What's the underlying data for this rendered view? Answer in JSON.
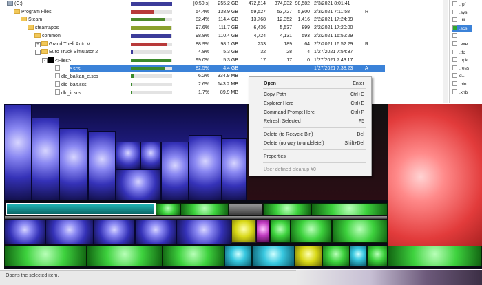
{
  "tree": {
    "rows": [
      {
        "indent": 0,
        "icon": "drive",
        "expander": "",
        "name": "(C:)",
        "fill": 1.0,
        "fill_color": "#3c3c9a",
        "percent": "[0:50 s]",
        "size": "255.2 GB",
        "items": "472,614",
        "files": "374,032",
        "subdirs": "98,582",
        "modified": "2/3/2021 8:01:41",
        "attr": ""
      },
      {
        "indent": 1,
        "icon": "folder",
        "expander": "",
        "name": "Program Files",
        "fill": 0.544,
        "fill_color": "#b83a3a",
        "percent": "54.4%",
        "size": "138.9 GB",
        "items": "59,527",
        "files": "53,727",
        "subdirs": "5,800",
        "modified": "2/3/2021 7:11:58",
        "attr": "R"
      },
      {
        "indent": 2,
        "icon": "folder",
        "expander": "",
        "name": "Steam",
        "fill": 0.824,
        "fill_color": "#4d8a2c",
        "percent": "82.4%",
        "size": "114.4 GB",
        "items": "13,768",
        "files": "12,352",
        "subdirs": "1,416",
        "modified": "2/2/2021 17:24:09",
        "attr": ""
      },
      {
        "indent": 3,
        "icon": "folder",
        "expander": "",
        "name": "steamapps",
        "fill": 0.976,
        "fill_color": "#8ba12e",
        "percent": "97.6%",
        "size": "111.7 GB",
        "items": "6,436",
        "files": "5,537",
        "subdirs": "899",
        "modified": "2/2/2021 17:20:00",
        "attr": ""
      },
      {
        "indent": 4,
        "icon": "folder",
        "expander": "",
        "name": "common",
        "fill": 0.988,
        "fill_color": "#3c3c9a",
        "percent": "98.8%",
        "size": "110.4 GB",
        "items": "4,724",
        "files": "4,131",
        "subdirs": "593",
        "modified": "2/2/2021 16:52:29",
        "attr": ""
      },
      {
        "indent": 5,
        "icon": "folder",
        "expander": "+",
        "name": "Grand Theft Auto V",
        "fill": 0.889,
        "fill_color": "#b83a3a",
        "percent": "88.9%",
        "size": "98.1 GB",
        "items": "233",
        "files": "189",
        "subdirs": "64",
        "modified": "2/2/2021 16:52:29",
        "attr": "R"
      },
      {
        "indent": 5,
        "icon": "folder",
        "expander": "-",
        "name": "Euro Truck Simulator 2",
        "fill": 0.048,
        "fill_color": "#3c3c9a",
        "percent": "4.8%",
        "size": "5.3 GB",
        "items": "32",
        "files": "28",
        "subdirs": "4",
        "modified": "1/27/2021 7:54:37",
        "attr": ""
      },
      {
        "indent": 6,
        "icon": "black",
        "expander": "-",
        "name": "<Files>",
        "fill": 0.99,
        "fill_color": "#3b8a2c",
        "percent": "99.0%",
        "size": "5.3 GB",
        "items": "17",
        "files": "17",
        "subdirs": "0",
        "modified": "1/27/2021 7:43:17",
        "attr": ""
      },
      {
        "indent": 7,
        "icon": "file",
        "expander": "",
        "name": "base.scs",
        "fill": 0.825,
        "fill_color": "#3b8a2c",
        "percent": "82.5%",
        "size": "4.4 GB",
        "items": "",
        "files": "",
        "subdirs": "",
        "modified": "1/27/2021 7:38:23",
        "attr": "A",
        "selected": true
      },
      {
        "indent": 7,
        "icon": "file",
        "expander": "",
        "name": "dlc_balkan_e.scs",
        "fill": 0.062,
        "fill_color": "#3b8a2c",
        "percent": "6.2%",
        "size": "334.9 MB",
        "items": "",
        "files": "",
        "subdirs": "",
        "modified": "",
        "attr": ""
      },
      {
        "indent": 7,
        "icon": "file",
        "expander": "",
        "name": "dlc_balt.scs",
        "fill": 0.026,
        "fill_color": "#3b8a2c",
        "percent": "2.6%",
        "size": "143.2 MB",
        "items": "",
        "files": "",
        "subdirs": "",
        "modified": "",
        "attr": ""
      },
      {
        "indent": 7,
        "icon": "file",
        "expander": "",
        "name": "dlc_it.scs",
        "fill": 0.017,
        "fill_color": "#3b8a2c",
        "percent": "1.7%",
        "size": "89.9 MB",
        "items": "",
        "files": "",
        "subdirs": "",
        "modified": "",
        "attr": ""
      }
    ]
  },
  "extensions": [
    {
      "label": ".rpf",
      "color": "#ffffff"
    },
    {
      "label": ".sys",
      "color": "#ffffff"
    },
    {
      "label": ".dll",
      "color": "#ffffff"
    },
    {
      "label": ".scs",
      "color": "#2ea82e",
      "selected": true
    },
    {
      "label": "",
      "color": "#ffffff"
    },
    {
      "label": ".exe",
      "color": "#ffffff"
    },
    {
      "label": ".tfc",
      "color": "#ffffff"
    },
    {
      "label": ".upk",
      "color": "#ffffff"
    },
    {
      "label": ".ress",
      "color": "#ffffff"
    },
    {
      "label": "d...",
      "color": "#ffffff"
    },
    {
      "label": ".bin",
      "color": "#ffffff"
    },
    {
      "label": ".xnb",
      "color": "#ffffff"
    }
  ],
  "context_menu": {
    "items": [
      {
        "label": "Open",
        "shortcut": "Enter",
        "bold": true,
        "disabled": false
      },
      {
        "label": "Copy Path",
        "shortcut": "Ctrl+C",
        "bold": false,
        "disabled": false
      },
      {
        "label": "Explorer Here",
        "shortcut": "Ctrl+E",
        "bold": false,
        "disabled": false
      },
      {
        "label": "Command Prompt Here",
        "shortcut": "Ctrl+P",
        "bold": false,
        "disabled": false
      },
      {
        "label": "Refresh Selected",
        "shortcut": "F5",
        "bold": false,
        "disabled": false
      },
      {
        "label": "Delete (to Recycle Bin)",
        "shortcut": "Del",
        "bold": false,
        "disabled": false
      },
      {
        "label": "Delete (no way to undelete!)",
        "shortcut": "Shift+Del",
        "bold": false,
        "disabled": false
      },
      {
        "label": "Properties",
        "shortcut": "",
        "bold": false,
        "disabled": false
      },
      {
        "label": "User defined cleanup #0",
        "shortcut": "",
        "bold": false,
        "disabled": true
      }
    ]
  },
  "status_bar": {
    "text": "Opens the selected item."
  },
  "colors": {
    "selection": "#3b82d8",
    "treemap_blue": "#3532b8",
    "treemap_pink": "#e23b3b",
    "treemap_green": "#3ed23e"
  }
}
